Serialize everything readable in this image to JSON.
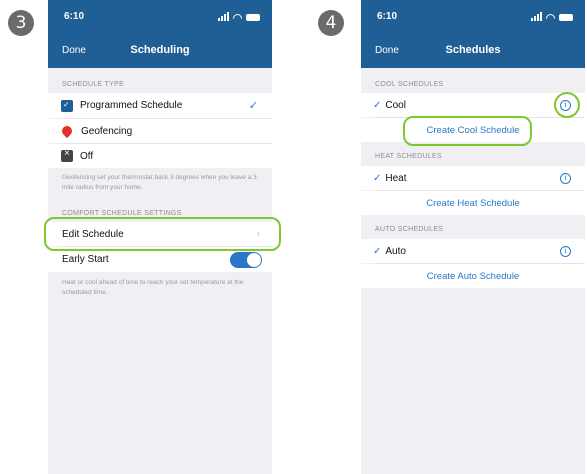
{
  "steps": {
    "left": "3",
    "right": "4"
  },
  "left_phone": {
    "status": {
      "time": "6:10"
    },
    "nav": {
      "done": "Done",
      "title": "Scheduling"
    },
    "schedule_type_label": "SCHEDULE TYPE",
    "options": [
      {
        "label": "Programmed Schedule",
        "icon": "calendar-icon",
        "selected": true
      },
      {
        "label": "Geofencing",
        "icon": "location-pin-icon",
        "selected": false
      },
      {
        "label": "Off",
        "icon": "off-icon",
        "selected": false
      }
    ],
    "geofencing_note": "Geofencing set your thermostat back 3 degrees when you leave a 3 mile radius from your home.",
    "comfort_label": "COMFORT SCHEDULE SETTINGS",
    "edit_schedule": "Edit Schedule",
    "early_start": "Early Start",
    "early_start_on": true,
    "early_start_note": "Heat or cool ahead of time to reach your set temperature at the scheduled time."
  },
  "right_phone": {
    "status": {
      "time": "6:10"
    },
    "nav": {
      "done": "Done",
      "title": "Schedules"
    },
    "sections": [
      {
        "label": "COOL SCHEDULES",
        "item": "Cool",
        "create": "Create Cool Schedule"
      },
      {
        "label": "HEAT SCHEDULES",
        "item": "Heat",
        "create": "Create Heat Schedule"
      },
      {
        "label": "AUTO SCHEDULES",
        "item": "Auto",
        "create": "Create Auto Schedule"
      }
    ]
  },
  "colors": {
    "nav": "#1f5f95",
    "accent": "#2a77c7",
    "highlight": "#7ec72f"
  }
}
